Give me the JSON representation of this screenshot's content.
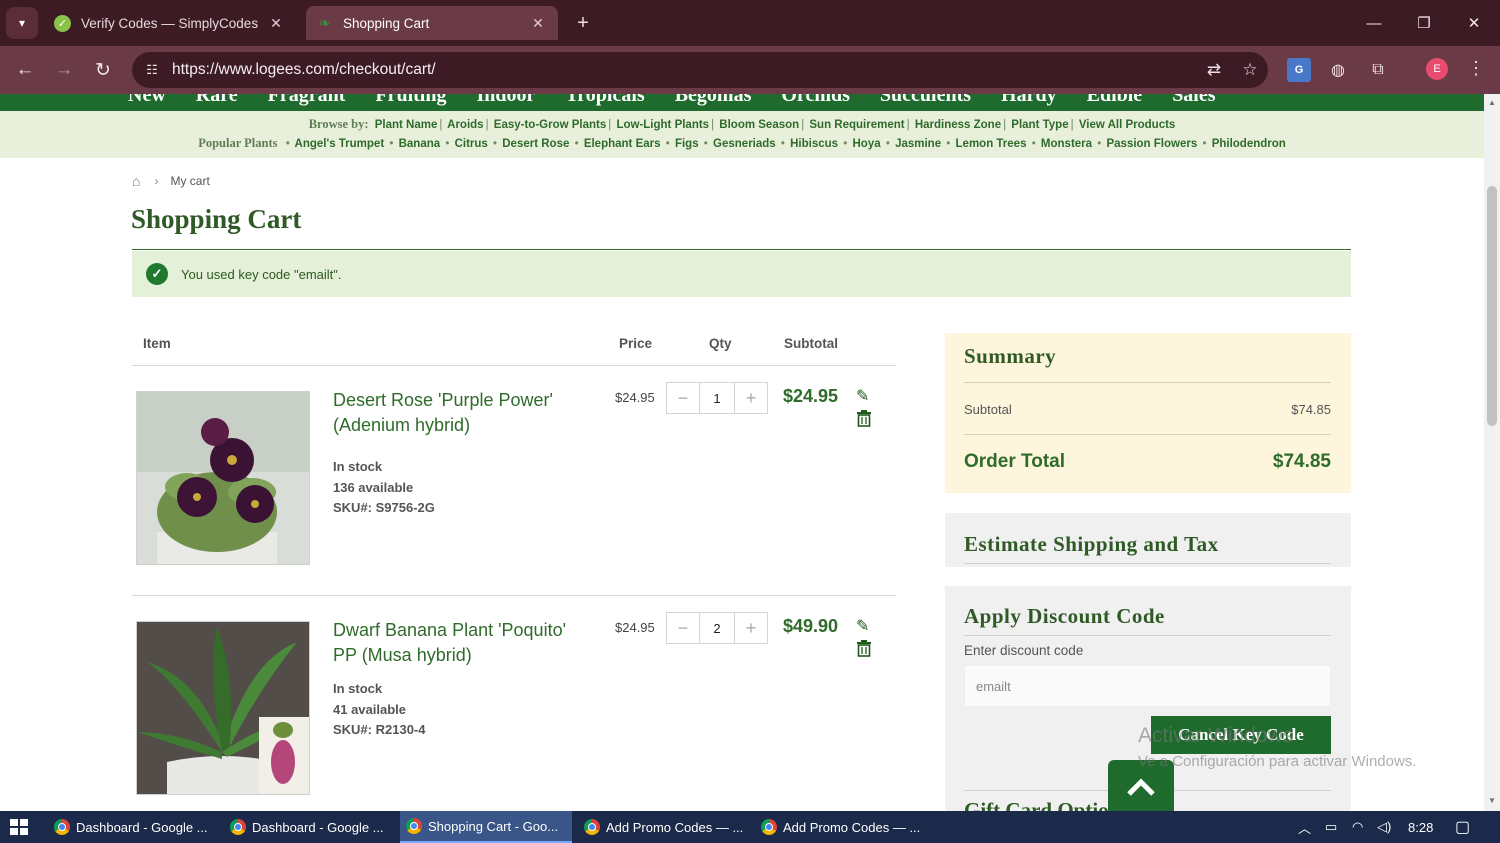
{
  "browser": {
    "tabs": [
      {
        "title": "Verify Codes — SimplyCodes",
        "favicon": "simplycodes-icon"
      },
      {
        "title": "Shopping Cart",
        "favicon": "logees-leaf-icon"
      }
    ],
    "url": "https://www.logees.com/checkout/cart/",
    "profile_initial": "E"
  },
  "site": {
    "main_nav": [
      "New",
      "Rare",
      "Fragrant",
      "Fruiting",
      "Indoor",
      "Tropicals",
      "Begonias",
      "Orchids",
      "Succulents",
      "Hardy",
      "Edible",
      "Sales"
    ],
    "browse_label": "Browse by:",
    "browse_links": [
      "Plant Name",
      "Aroids",
      "Easy-to-Grow Plants",
      "Low-Light Plants",
      "Bloom Season",
      "Sun Requirement",
      "Hardiness Zone",
      "Plant Type",
      "View All Products"
    ],
    "popular_label": "Popular Plants",
    "popular_links": [
      "Angel's Trumpet",
      "Banana",
      "Citrus",
      "Desert Rose",
      "Elephant Ears",
      "Figs",
      "Gesneriads",
      "Hibiscus",
      "Hoya",
      "Jasmine",
      "Lemon Trees",
      "Monstera",
      "Passion Flowers",
      "Philodendron"
    ]
  },
  "breadcrumb": {
    "current": "My cart"
  },
  "page": {
    "title": "Shopping Cart",
    "notice": "You used key code \"emailt\"."
  },
  "cart": {
    "headers": {
      "item": "Item",
      "price": "Price",
      "qty": "Qty",
      "subtotal": "Subtotal"
    },
    "items": [
      {
        "name": "Desert Rose 'Purple Power' (Adenium hybrid)",
        "stock": "In stock",
        "available": "136 available",
        "sku": "SKU#: S9756-2G",
        "price": "$24.95",
        "qty": "1",
        "subtotal": "$24.95"
      },
      {
        "name": "Dwarf Banana Plant 'Poquito' PP (Musa hybrid)",
        "stock": "In stock",
        "available": "41 available",
        "sku": "SKU#: R2130-4",
        "price": "$24.95",
        "qty": "2",
        "subtotal": "$49.90"
      }
    ]
  },
  "summary": {
    "heading": "Summary",
    "subtotal_label": "Subtotal",
    "subtotal_value": "$74.85",
    "total_label": "Order Total",
    "total_value": "$74.85"
  },
  "shipping": {
    "heading": "Estimate Shipping and Tax"
  },
  "discount": {
    "heading": "Apply Discount Code",
    "label": "Enter discount code",
    "placeholder": "emailt",
    "button": "Cancel Key Code"
  },
  "gift": {
    "heading": "Gift Card Options"
  },
  "watermark": {
    "line1": "Activar Windows",
    "line2": "Ve a Configuración para activar Windows."
  },
  "taskbar": {
    "items": [
      "Dashboard - Google ...",
      "Dashboard - Google ...",
      "Shopping Cart - Goo...",
      "Add Promo Codes — ...",
      "Add Promo Codes — ..."
    ],
    "time": "8:28"
  },
  "colors": {
    "brand_green": "#1e6b2d",
    "browser_frame": "#3d1b25",
    "summary_bg": "#fdf6dc"
  }
}
